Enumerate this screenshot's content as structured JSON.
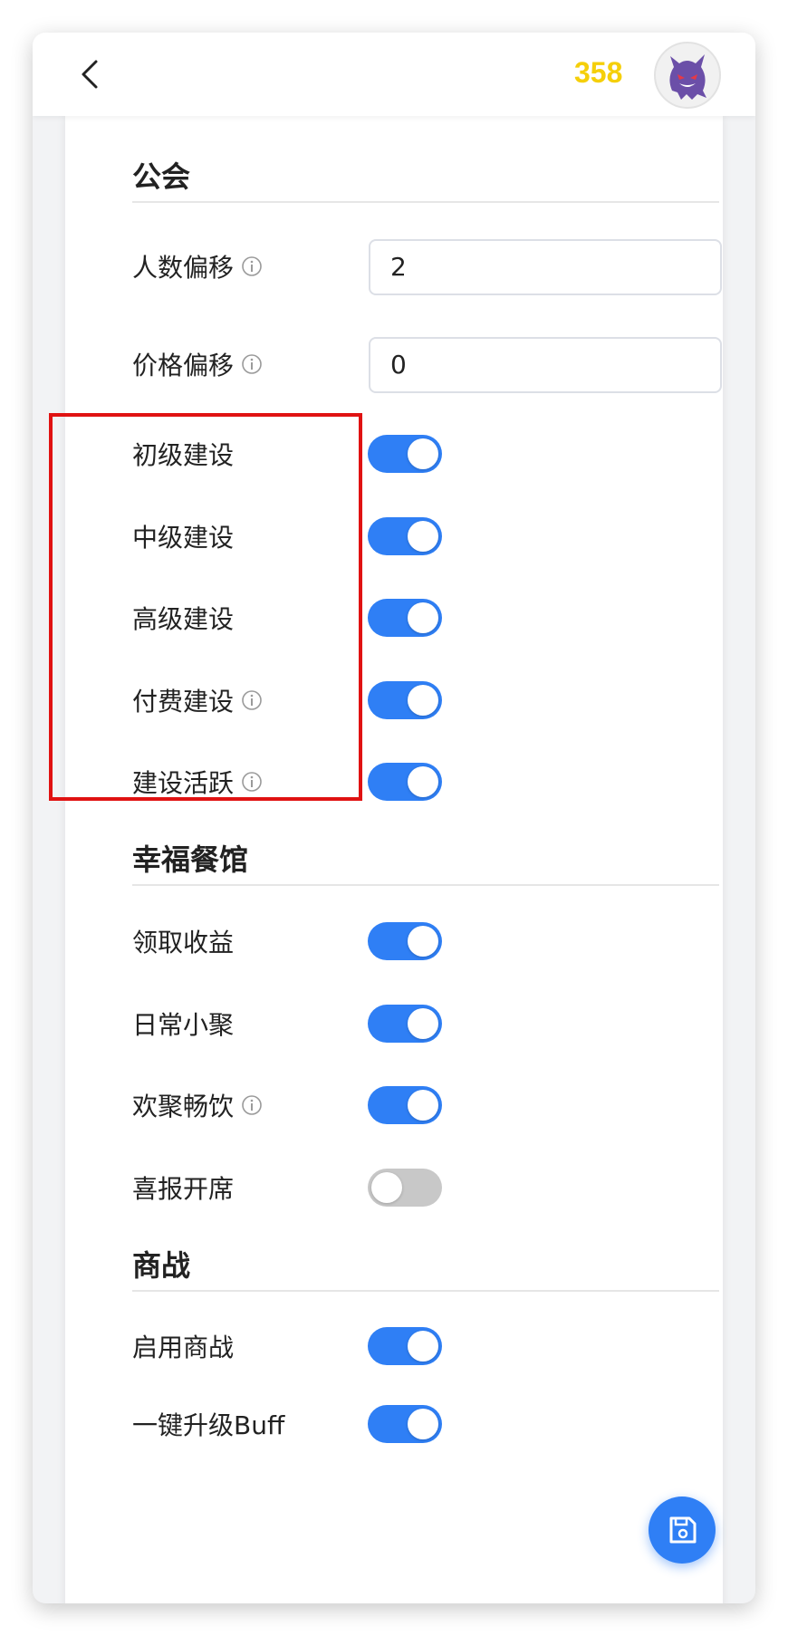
{
  "header": {
    "back_icon": "chevron-left-icon",
    "coins": "358",
    "avatar_icon": "ghost-avatar"
  },
  "guild": {
    "title": "公会",
    "member_offset_label": "人数偏移",
    "member_offset_value": "2",
    "price_offset_label": "价格偏移",
    "price_offset_value": "0",
    "toggles": [
      {
        "label": "初级建设",
        "on": true,
        "info": false
      },
      {
        "label": "中级建设",
        "on": true,
        "info": false
      },
      {
        "label": "高级建设",
        "on": true,
        "info": false
      },
      {
        "label": "付费建设",
        "on": true,
        "info": true
      },
      {
        "label": "建设活跃",
        "on": true,
        "info": true
      }
    ]
  },
  "restaurant": {
    "title": "幸福餐馆",
    "toggles": [
      {
        "label": "领取收益",
        "on": true,
        "info": false
      },
      {
        "label": "日常小聚",
        "on": true,
        "info": false
      },
      {
        "label": "欢聚畅饮",
        "on": true,
        "info": true
      },
      {
        "label": "喜报开席",
        "on": false,
        "info": false
      }
    ]
  },
  "business_war": {
    "title": "商战",
    "toggles": [
      {
        "label": "启用商战",
        "on": true,
        "info": false
      },
      {
        "label": "一键升级Buff",
        "on": true,
        "info": false
      }
    ]
  },
  "fab": {
    "icon": "save-icon"
  },
  "colors": {
    "accent": "#2f7ff5",
    "coins": "#f5cf0a",
    "highlight": "#e01212",
    "switch_off": "#c8c8c8"
  }
}
